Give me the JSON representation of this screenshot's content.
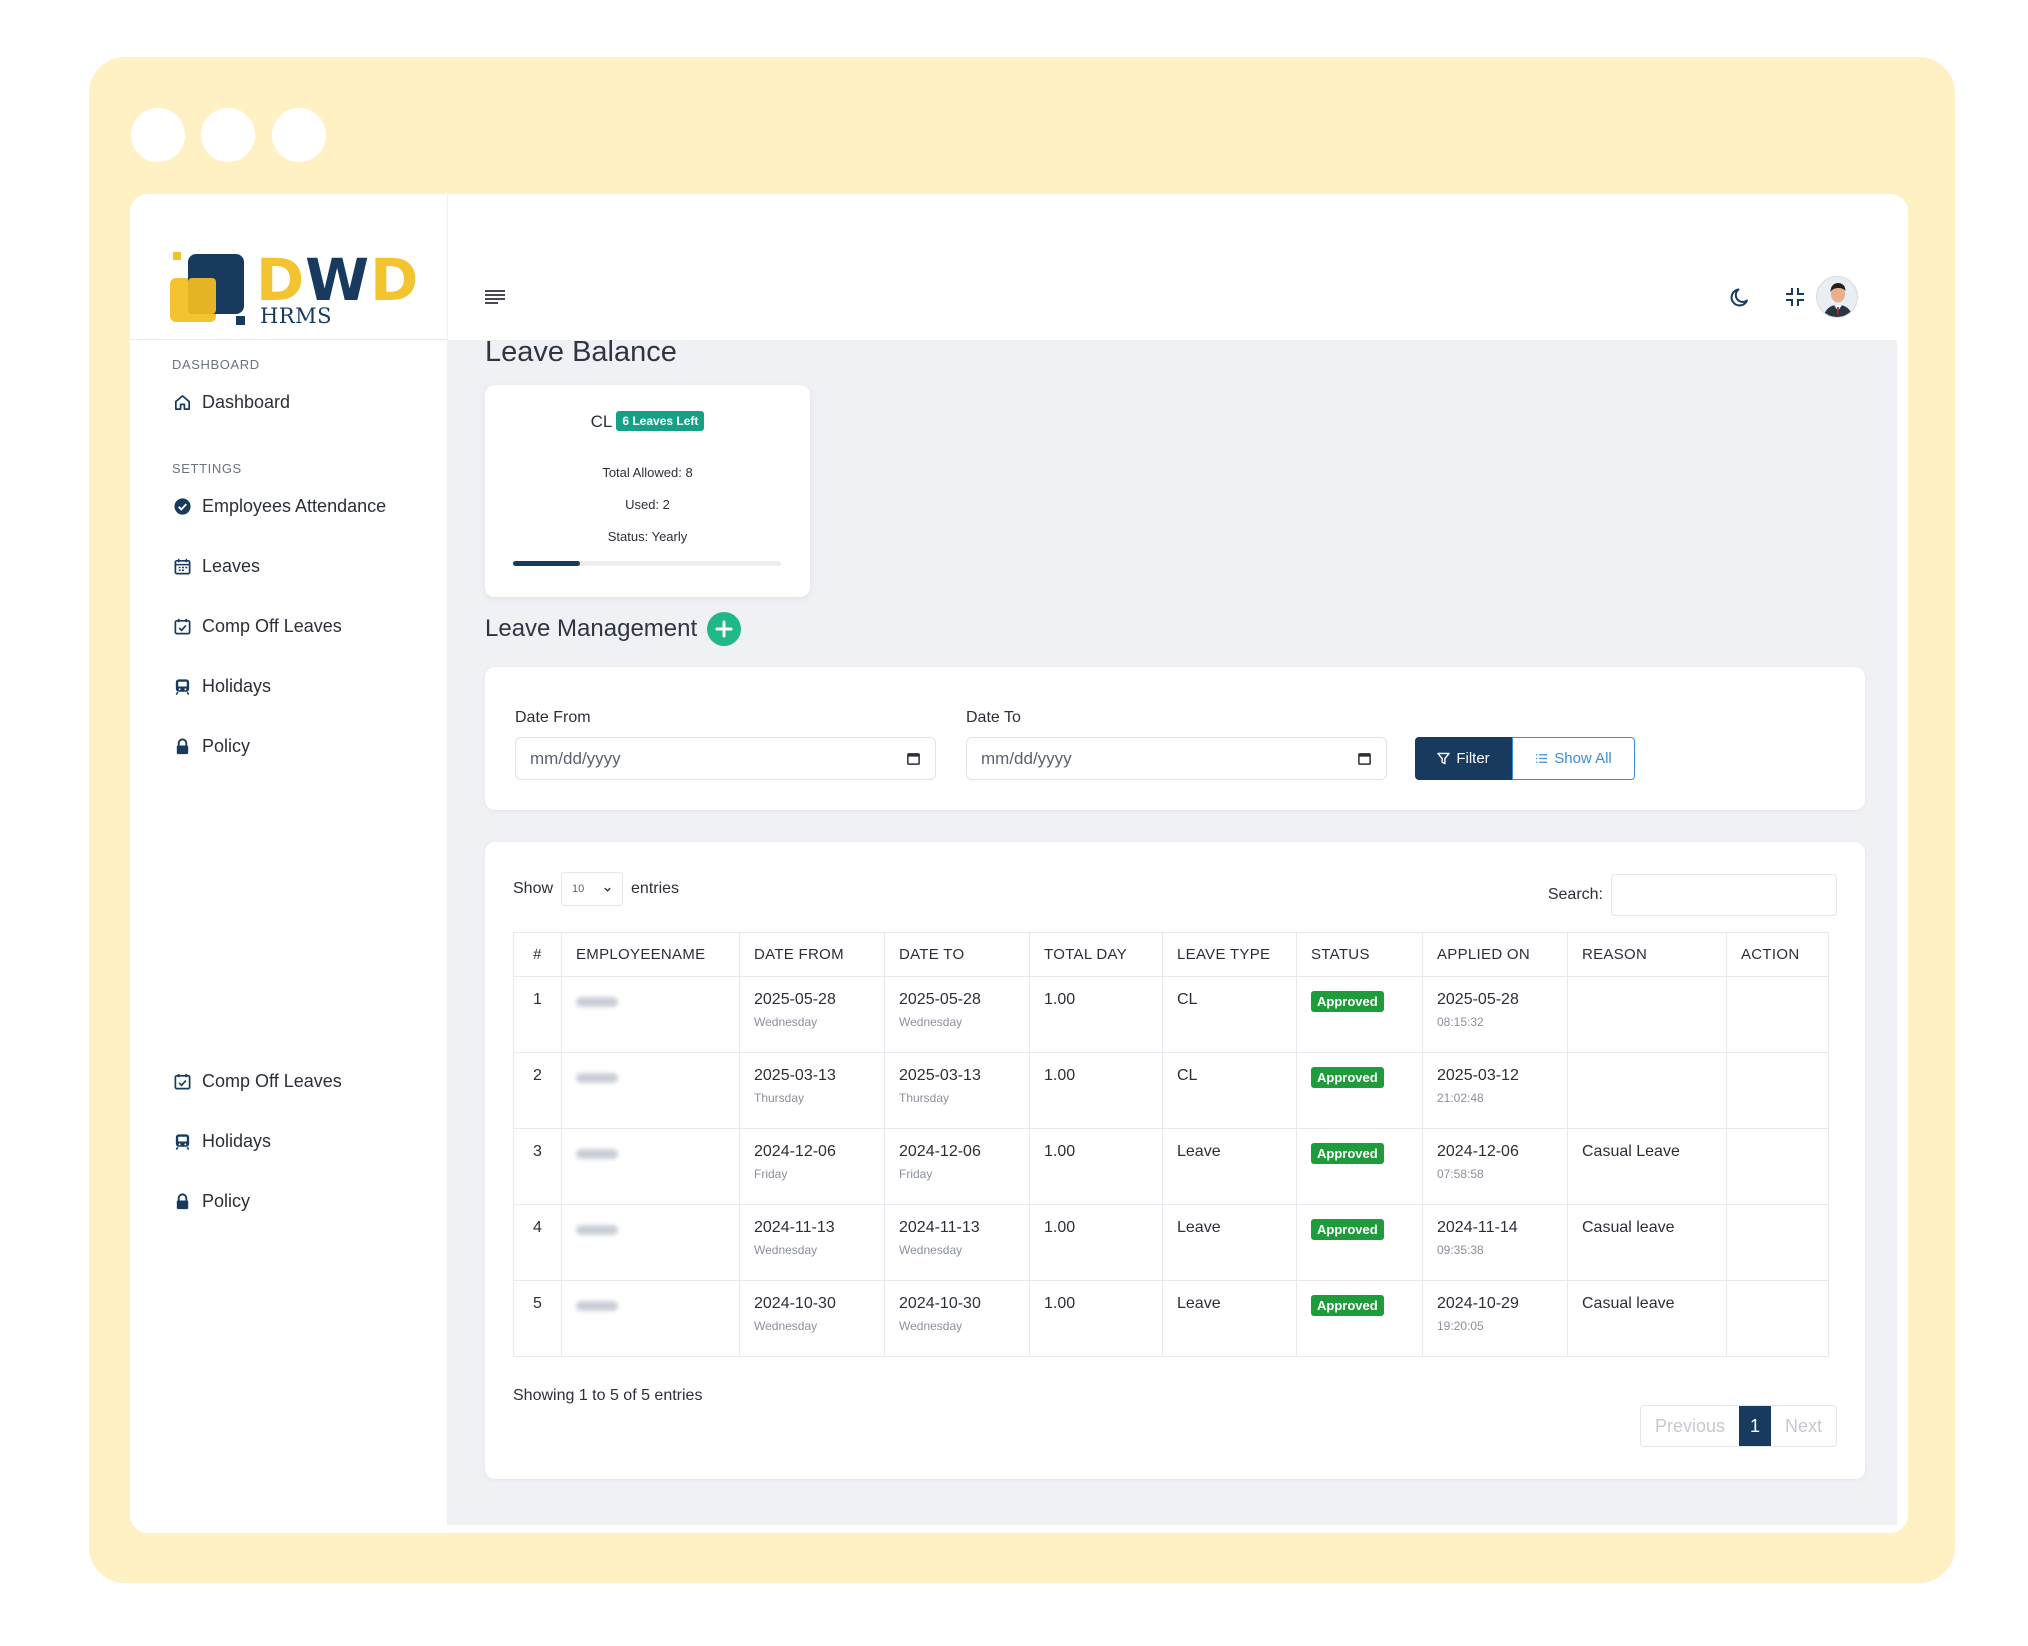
{
  "brand": {
    "logo_word_a": "D",
    "logo_word_b": "W",
    "logo_word_c": "D",
    "logo_sub": "HRMS"
  },
  "sidebar": {
    "section_dashboard": "DASHBOARD",
    "dashboard": "Dashboard",
    "section_settings": "SETTINGS",
    "items": [
      {
        "label": "Employees Attendance",
        "icon": "check-circle-icon"
      },
      {
        "label": "Leaves",
        "icon": "calendar-icon"
      },
      {
        "label": "Comp Off Leaves",
        "icon": "calendar-check-icon"
      },
      {
        "label": "Holidays",
        "icon": "globe-icon"
      },
      {
        "label": "Policy",
        "icon": "lock-icon"
      }
    ],
    "repeat_items": [
      {
        "label": "Comp Off Leaves",
        "icon": "calendar-check-icon"
      },
      {
        "label": "Holidays",
        "icon": "globe-icon"
      },
      {
        "label": "Policy",
        "icon": "lock-icon"
      }
    ]
  },
  "header": {
    "icons": [
      "menu-icon",
      "moon-icon",
      "collapse-icon",
      "avatar"
    ]
  },
  "leave_balance": {
    "title": "Leave Balance",
    "type": "CL",
    "badge": "6 Leaves Left",
    "total_allowed_label": "Total Allowed:",
    "total_allowed": "8",
    "used_label": "Used:",
    "used": "2",
    "status_label": "Status:",
    "status": "Yearly",
    "used_fraction": 0.25
  },
  "leave_management": {
    "title": "Leave Management",
    "date_from_label": "Date From",
    "date_to_label": "Date To",
    "date_placeholder": "mm/dd/yyyy",
    "filter_btn": "Filter",
    "show_all_btn": "Show All"
  },
  "table": {
    "show_label": "Show",
    "entries_value": "10",
    "entries_label": "entries",
    "search_label": "Search:",
    "columns": [
      "#",
      "EMPLOYEENAME",
      "DATE FROM",
      "DATE TO",
      "TOTAL DAY",
      "LEAVE TYPE",
      "STATUS",
      "APPLIED ON",
      "REASON",
      "ACTION"
    ],
    "rows": [
      {
        "n": "1",
        "from": "2025-05-28",
        "from_day": "Wednesday",
        "to": "2025-05-28",
        "to_day": "Wednesday",
        "total": "1.00",
        "type": "CL",
        "status": "Approved",
        "applied": "2025-05-28",
        "applied_time": "08:15:32",
        "reason": ""
      },
      {
        "n": "2",
        "from": "2025-03-13",
        "from_day": "Thursday",
        "to": "2025-03-13",
        "to_day": "Thursday",
        "total": "1.00",
        "type": "CL",
        "status": "Approved",
        "applied": "2025-03-12",
        "applied_time": "21:02:48",
        "reason": ""
      },
      {
        "n": "3",
        "from": "2024-12-06",
        "from_day": "Friday",
        "to": "2024-12-06",
        "to_day": "Friday",
        "total": "1.00",
        "type": "Leave",
        "status": "Approved",
        "applied": "2024-12-06",
        "applied_time": "07:58:58",
        "reason": "Casual Leave"
      },
      {
        "n": "4",
        "from": "2024-11-13",
        "from_day": "Wednesday",
        "to": "2024-11-13",
        "to_day": "Wednesday",
        "total": "1.00",
        "type": "Leave",
        "status": "Approved",
        "applied": "2024-11-14",
        "applied_time": "09:35:38",
        "reason": "Casual leave"
      },
      {
        "n": "5",
        "from": "2024-10-30",
        "from_day": "Wednesday",
        "to": "2024-10-30",
        "to_day": "Wednesday",
        "total": "1.00",
        "type": "Leave",
        "status": "Approved",
        "applied": "2024-10-29",
        "applied_time": "19:20:05",
        "reason": "Casual leave"
      }
    ],
    "showing": "Showing 1 to 5 of 5 entries",
    "pager": {
      "prev": "Previous",
      "page": "1",
      "next": "Next"
    }
  }
}
